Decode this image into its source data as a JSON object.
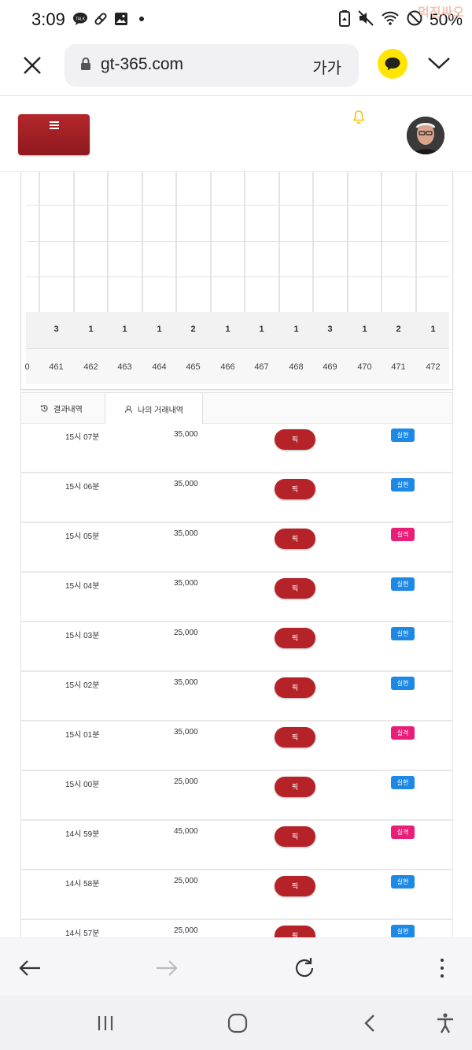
{
  "status_bar": {
    "time": "3:09",
    "battery": "50%",
    "watermark": "먹진싸오",
    "left_icons": [
      "talk-icon",
      "pill-icon",
      "image-icon",
      "dot-icon"
    ],
    "right_icons": [
      "recycle-icon",
      "mute-icon",
      "wifi-icon",
      "no-disturb-icon"
    ]
  },
  "browser": {
    "url": "gt-365.com",
    "text_size_label": "가가",
    "kakao_color": "#ffe500"
  },
  "site": {
    "menu_button_color": "#a1202a",
    "bell_color": "#f2c400"
  },
  "grid": {
    "counts": [
      "3",
      "1",
      "1",
      "1",
      "2",
      "1",
      "1",
      "1",
      "3",
      "1",
      "2",
      "1"
    ],
    "rounds": [
      "461",
      "462",
      "463",
      "464",
      "465",
      "466",
      "467",
      "468",
      "469",
      "470",
      "471",
      "472"
    ],
    "partial_left": "0"
  },
  "tabs": {
    "results": "결과내역",
    "my_history": "나의 거래내역"
  },
  "history": [
    {
      "time": "15시 07분",
      "amount": "35,000",
      "pick": "픽",
      "result": "실현",
      "type": "blue"
    },
    {
      "time": "15시 06분",
      "amount": "35,000",
      "pick": "픽",
      "result": "실현",
      "type": "blue"
    },
    {
      "time": "15시 05분",
      "amount": "35,000",
      "pick": "픽",
      "result": "실격",
      "type": "pink"
    },
    {
      "time": "15시 04분",
      "amount": "35,000",
      "pick": "픽",
      "result": "실현",
      "type": "blue"
    },
    {
      "time": "15시 03분",
      "amount": "25,000",
      "pick": "픽",
      "result": "실현",
      "type": "blue"
    },
    {
      "time": "15시 02분",
      "amount": "35,000",
      "pick": "픽",
      "result": "실현",
      "type": "blue"
    },
    {
      "time": "15시 01분",
      "amount": "35,000",
      "pick": "픽",
      "result": "실격",
      "type": "pink"
    },
    {
      "time": "15시 00분",
      "amount": "25,000",
      "pick": "픽",
      "result": "실현",
      "type": "blue"
    },
    {
      "time": "14시 59분",
      "amount": "45,000",
      "pick": "픽",
      "result": "실격",
      "type": "pink"
    },
    {
      "time": "14시 58분",
      "amount": "25,000",
      "pick": "픽",
      "result": "실현",
      "type": "blue"
    },
    {
      "time": "14시 57분",
      "amount": "25,000",
      "pick": "픽",
      "result": "실현",
      "type": "blue"
    }
  ]
}
